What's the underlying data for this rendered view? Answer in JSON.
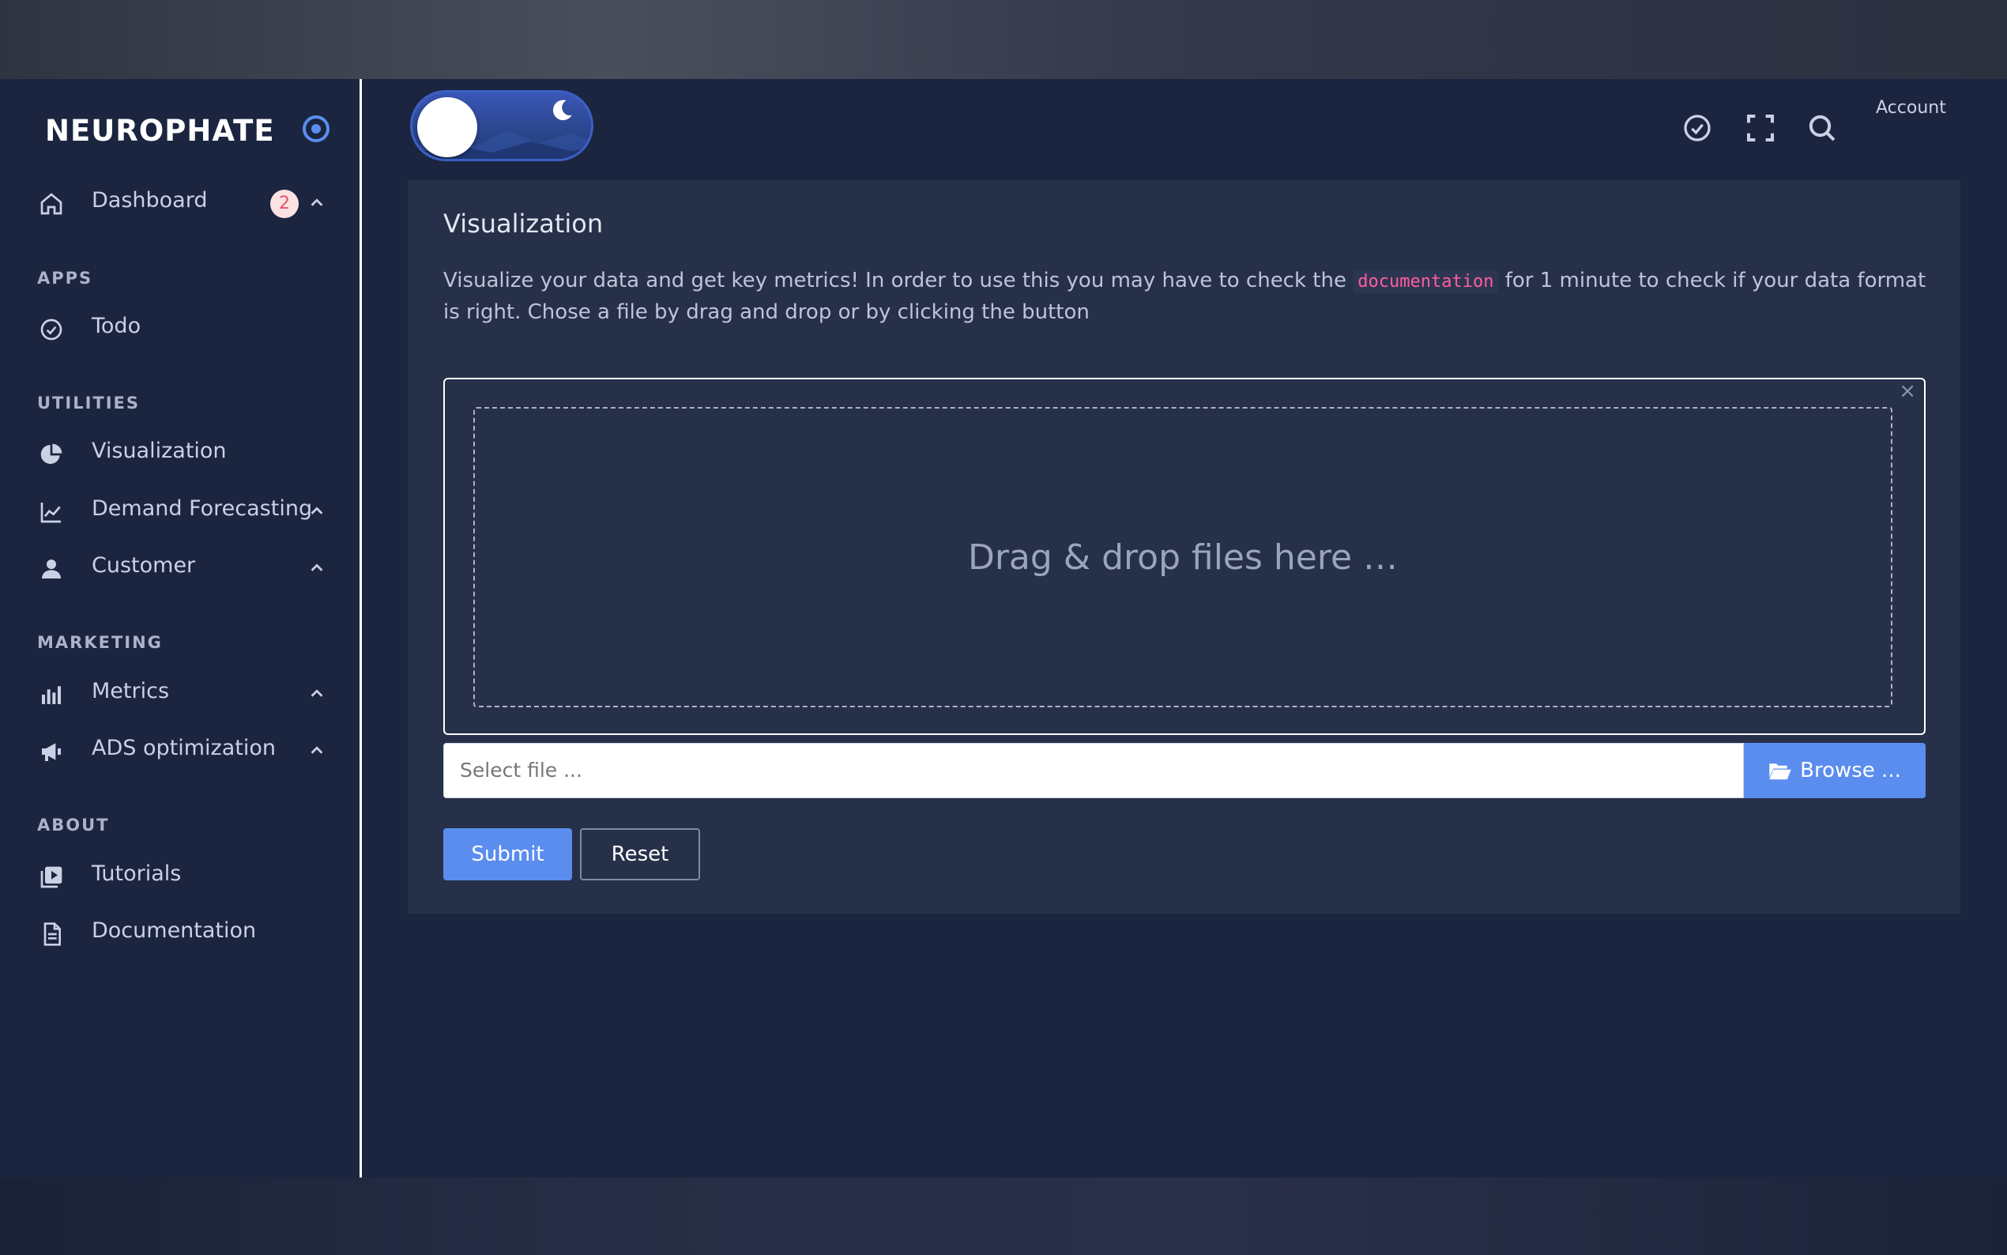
{
  "brand": {
    "name": "NEUROPHATE"
  },
  "sidebar": {
    "dashboard": {
      "label": "Dashboard",
      "badge": "2"
    },
    "sections": {
      "apps": "APPS",
      "utilities": "UTILITIES",
      "marketing": "MARKETING",
      "about": "ABOUT"
    },
    "items": {
      "todo": "Todo",
      "visualization": "Visualization",
      "demand_forecasting": "Demand Forecasting",
      "customer": "Customer",
      "metrics": "Metrics",
      "ads_optimization": "ADS optimization",
      "tutorials": "Tutorials",
      "documentation": "Documentation"
    }
  },
  "header": {
    "account_label": "Account",
    "icons": [
      "check-circle-icon",
      "fullscreen-icon",
      "search-icon"
    ]
  },
  "card": {
    "title": "Visualization",
    "text_before": "Visualize your data and get key metrics! In order to use this you may have to check the",
    "code": "documentation",
    "text_after": "for 1 minute to check if your data format is right. Chose a file by drag and drop or by clicking the button",
    "dropzone_text": "Drag & drop files here …",
    "dropzone_close": "×",
    "file_placeholder": "Select file ...",
    "browse_label": "Browse ...",
    "submit_label": "Submit",
    "reset_label": "Reset"
  },
  "colors": {
    "background": "#1b2540",
    "card": "#263049",
    "accent": "#5b8def",
    "code": "#ff5da2",
    "badge_bg": "#fde2e4",
    "badge_text": "#e4526a"
  }
}
